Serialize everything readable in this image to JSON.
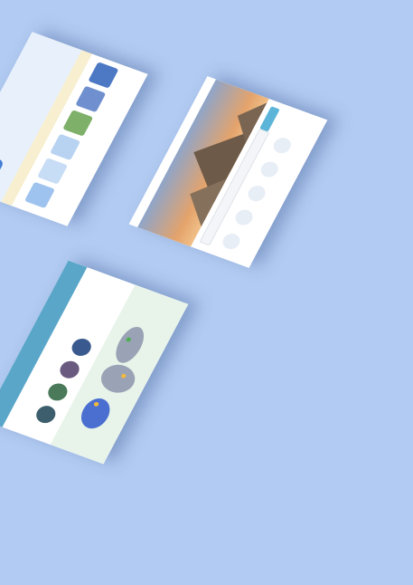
{
  "mockups": [
    {
      "id": "kids-page",
      "title_line1": "",
      "title_line2": "",
      "colors": {
        "panel": "#e7f0fb",
        "accent": "#3f7dd6",
        "sand": "#f7efcf"
      }
    },
    {
      "id": "travel-page",
      "title_line1": "",
      "title_line2": "",
      "colors": {
        "sky": "#d7a070",
        "pyramid": "#6e5a48",
        "button": "#5cb5d8",
        "nav": "#ffffff"
      }
    },
    {
      "id": "map-page",
      "title_line1": "",
      "colors": {
        "header": "#5aa6c9",
        "panel": "#e8f4ea",
        "map": "#7f8fbf"
      }
    }
  ]
}
